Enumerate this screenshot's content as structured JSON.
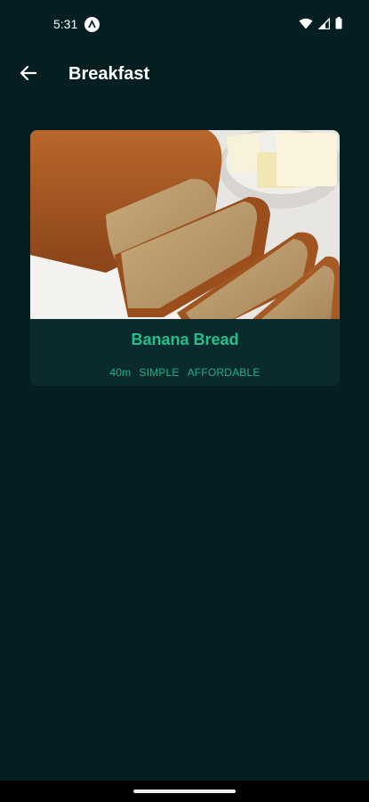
{
  "status": {
    "time": "5:31",
    "icons": [
      "app-notification-icon",
      "wifi-icon",
      "signal-icon",
      "battery-icon"
    ]
  },
  "app_bar": {
    "back_icon": "arrow-back-icon",
    "title": "Breakfast"
  },
  "meals": [
    {
      "title": "Banana Bread",
      "duration": "40m",
      "complexity": "SIMPLE",
      "affordability": "AFFORDABLE"
    }
  ],
  "colors": {
    "background": "#041e22",
    "card": "#0a2a2e",
    "accent": "#22c08a"
  }
}
